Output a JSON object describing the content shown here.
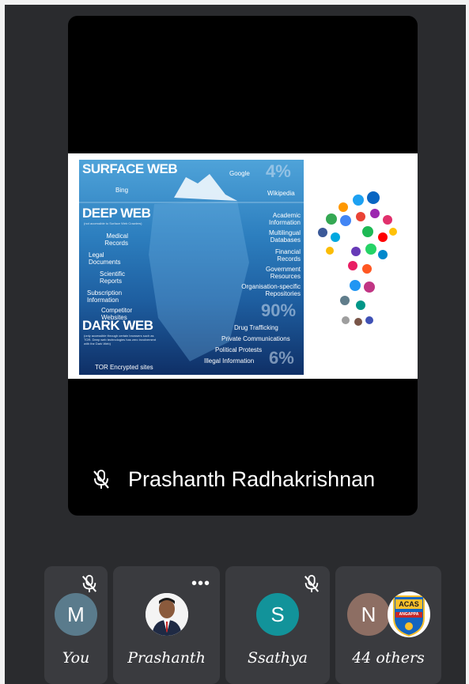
{
  "presenter": {
    "name": "Prashanth Radhakrishnan",
    "muted": true
  },
  "slide": {
    "surface_heading": "SURFACE WEB",
    "deep_heading": "DEEP WEB",
    "deep_note": "(not accessible to Surface Web Crawlers)",
    "dark_heading": "DARK WEB",
    "dark_note": "(only accessible through certain browsers such as TOR. Deep web technologies has zero involvement with the Dark Web)",
    "pct_surface": "4%",
    "pct_deep": "90%",
    "pct_dark": "6%",
    "surface_items": [
      "Google",
      "Bing",
      "Wikipedia"
    ],
    "deep_left": [
      "Medical Records",
      "Legal Documents",
      "Scientific Reports",
      "Subscription Information",
      "Competitor Websites"
    ],
    "deep_right": [
      "Academic Information",
      "Multilingual Databases",
      "Financial Records",
      "Government Resources",
      "Organisation-specific Repositories"
    ],
    "dark_items": [
      "Drug Trafficking",
      "Private Communications",
      "Political Protests",
      "Illegal Information"
    ],
    "dark_left": "TOR Encrypted sites"
  },
  "participants": [
    {
      "initial": "M",
      "label": "You",
      "color": "#5a7b8c",
      "muted": true
    },
    {
      "initial": "",
      "label": "Prashanth",
      "color": "#ffffff",
      "photo": true
    },
    {
      "initial": "S",
      "label": "Ssathya",
      "color": "#12939a",
      "muted": true
    },
    {
      "initial": "N",
      "label": "44 others",
      "color": "#8d6e63",
      "badge_top": "ACAS",
      "badge_bottom": "ANGAPPA"
    }
  ],
  "icons": [
    "mic-off-icon",
    "more-options-icon",
    "social-media-cluster"
  ]
}
